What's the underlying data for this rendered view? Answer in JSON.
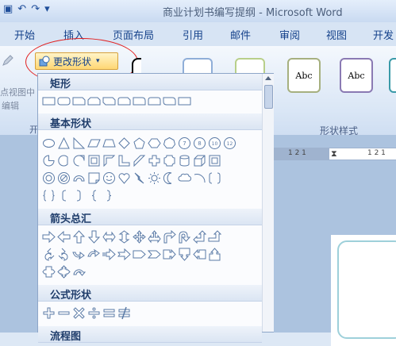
{
  "window": {
    "title": "商业计划书编写提纲 - Microsoft Word"
  },
  "tabs": [
    "开始",
    "插入",
    "页面布局",
    "引用",
    "邮件",
    "审阅",
    "视图",
    "开发"
  ],
  "left_group": {
    "line1": "点视图中",
    "line2": "编辑",
    "group_label": "开"
  },
  "change_shape": {
    "label": "更改形状"
  },
  "thumbnails": [
    {
      "label": "Abc"
    },
    {
      "label": "Abc"
    }
  ],
  "shape_styles_group": "形状样式",
  "colors": {
    "highlight": "#ffd774",
    "annotation": "#e21f1f",
    "accent": "#15428b"
  },
  "panel": {
    "sections": [
      {
        "name": "矩形"
      },
      {
        "name": "基本形状"
      },
      {
        "name": "箭头总汇"
      },
      {
        "name": "公式形状"
      },
      {
        "name": "流程图"
      }
    ]
  }
}
